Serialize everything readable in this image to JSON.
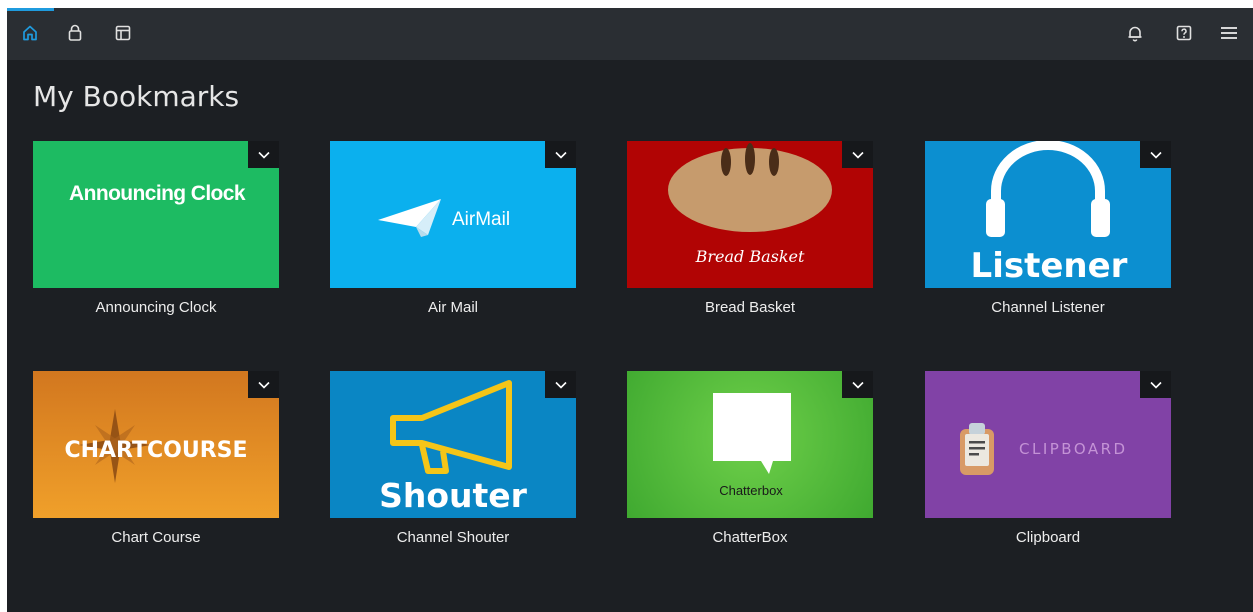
{
  "header": {
    "nav_icons": [
      "home-icon",
      "bag-icon",
      "layout-icon"
    ],
    "right_icons": [
      "bell-icon",
      "help-icon",
      "menu-icon"
    ],
    "accent_color": "#1f9bde"
  },
  "page": {
    "title": "My Bookmarks"
  },
  "bookmarks": [
    {
      "label": "Announcing Clock",
      "art_text": "Announcing Clock",
      "color": "#1dbb62"
    },
    {
      "label": "Air Mail",
      "art_text": "AirMail",
      "color": "#0bb0ee"
    },
    {
      "label": "Bread Basket",
      "art_text": "Bread Basket",
      "color": "#b10404"
    },
    {
      "label": "Channel Listener",
      "art_text": "Listener",
      "color": "#0c8fd0"
    },
    {
      "label": "Chart Course",
      "art_text": "CHARTCOURSE",
      "color": "#df8a1f"
    },
    {
      "label": "Channel Shouter",
      "art_text": "Shouter",
      "color": "#0a86c4"
    },
    {
      "label": "ChatterBox",
      "art_text": "Chatterbox",
      "color": "#56c43f"
    },
    {
      "label": "Clipboard",
      "art_text": "CLIPBOARD",
      "color": "#8142a6"
    }
  ]
}
